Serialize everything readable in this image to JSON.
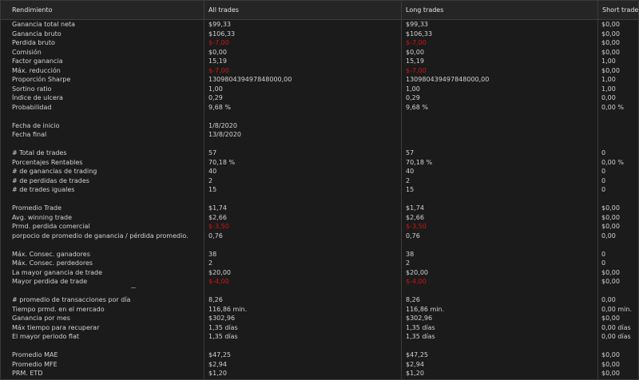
{
  "header": {
    "col0": "Rendimiento",
    "col1": "All trades",
    "col2": "Long trades",
    "col3": "Short trades"
  },
  "colors": {
    "background": "#1b1b1b",
    "header_bg": "#252525",
    "text": "#d2d2d2",
    "negative": "#d21414"
  },
  "rows": [
    {
      "label": "Ganancia total neta",
      "all": "$99,33",
      "long": "$99,33",
      "short": "$0,00"
    },
    {
      "label": "Ganancia bruto",
      "all": "$106,33",
      "long": "$106,33",
      "short": "$0,00"
    },
    {
      "label": "Perdida bruto",
      "all": "$-7,00",
      "long": "$-7,00",
      "short": "$0,00",
      "neg": true
    },
    {
      "label": "Comisión",
      "all": "$0,00",
      "long": "$0,00",
      "short": "$0,00"
    },
    {
      "label": "Factor ganancia",
      "all": "15,19",
      "long": "15,19",
      "short": "1,00"
    },
    {
      "label": "Máx. reducción",
      "all": "$-7,00",
      "long": "$-7,00",
      "short": "$0,00",
      "neg": true
    },
    {
      "label": "Proporción Sharpe",
      "all": "130980439497848000,00",
      "long": "130980439497848000,00",
      "short": "1,00"
    },
    {
      "label": "Sortino ratio",
      "all": "1,00",
      "long": "1,00",
      "short": "1,00"
    },
    {
      "label": "Índice de ulcera",
      "all": "0,29",
      "long": "0,29",
      "short": "0,00"
    },
    {
      "label": "Probabilidad",
      "all": "9,68 %",
      "long": "9,68 %",
      "short": "0,00 %"
    },
    {
      "gap": true
    },
    {
      "label": "Fecha de inicio",
      "all": "1/8/2020",
      "long": "",
      "short": ""
    },
    {
      "label": "Fecha final",
      "all": "13/8/2020",
      "long": "",
      "short": ""
    },
    {
      "gap": true
    },
    {
      "label": "# Total de trades",
      "all": "57",
      "long": "57",
      "short": "0"
    },
    {
      "label": "Porcentajes Rentables",
      "all": "70,18 %",
      "long": "70,18 %",
      "short": "0,00 %"
    },
    {
      "label": "# de ganancias de trading",
      "all": "40",
      "long": "40",
      "short": "0"
    },
    {
      "label": "# de perdidas de trades",
      "all": "2",
      "long": "2",
      "short": "0"
    },
    {
      "label": "# de trades iguales",
      "all": "15",
      "long": "15",
      "short": "0"
    },
    {
      "gap": true
    },
    {
      "label": "Promedio Trade",
      "all": "$1,74",
      "long": "$1,74",
      "short": "$0,00"
    },
    {
      "label": "Avg. winning trade",
      "all": "$2,66",
      "long": "$2,66",
      "short": "$0,00"
    },
    {
      "label": "Prmd. perdida comercial",
      "all": "$-3,50",
      "long": "$-3,50",
      "short": "$0,00",
      "neg": true
    },
    {
      "label": "porpocio de promedio de ganancia / pérdida promedio.",
      "all": "0,76",
      "long": "0,76",
      "short": "0,00"
    },
    {
      "gap": true
    },
    {
      "label": "Máx. Consec. ganadores",
      "all": "38",
      "long": "38",
      "short": "0"
    },
    {
      "label": "Máx. Consec. perdedores",
      "all": "2",
      "long": "2",
      "short": "0"
    },
    {
      "label": "La mayor ganancia de trade",
      "all": "$20,00",
      "long": "$20,00",
      "short": "$0,00"
    },
    {
      "label": "Mayor perdida de trade",
      "all": "$-4,00",
      "long": "$-4,00",
      "short": "$0,00",
      "neg": true
    },
    {
      "gap": true
    },
    {
      "label": "# promedio de transacciones por día",
      "all": "8,26",
      "long": "8,26",
      "short": "0,00"
    },
    {
      "label": "Tiempo prmd. en el mercado",
      "all": "116,86 min.",
      "long": "116,86 min.",
      "short": "0,00 min."
    },
    {
      "label": "Ganancia por mes",
      "all": "$302,96",
      "long": "$302,96",
      "short": "$0,00"
    },
    {
      "label": "Máx tiempo para recuperar",
      "all": "1,35 días",
      "long": "1,35 días",
      "short": "0,00 días"
    },
    {
      "label": "El mayor periodo flat",
      "all": "1,35 días",
      "long": "1,35 días",
      "short": "0,00 días"
    },
    {
      "gap": true
    },
    {
      "label": "Promedio MAE",
      "all": "$47,25",
      "long": "$47,25",
      "short": "$0,00"
    },
    {
      "label": "Promedio MFE",
      "all": "$2,94",
      "long": "$2,94",
      "short": "$0,00"
    },
    {
      "label": "PRM. ETD",
      "all": "$1,20",
      "long": "$1,20",
      "short": "$0,00"
    }
  ]
}
